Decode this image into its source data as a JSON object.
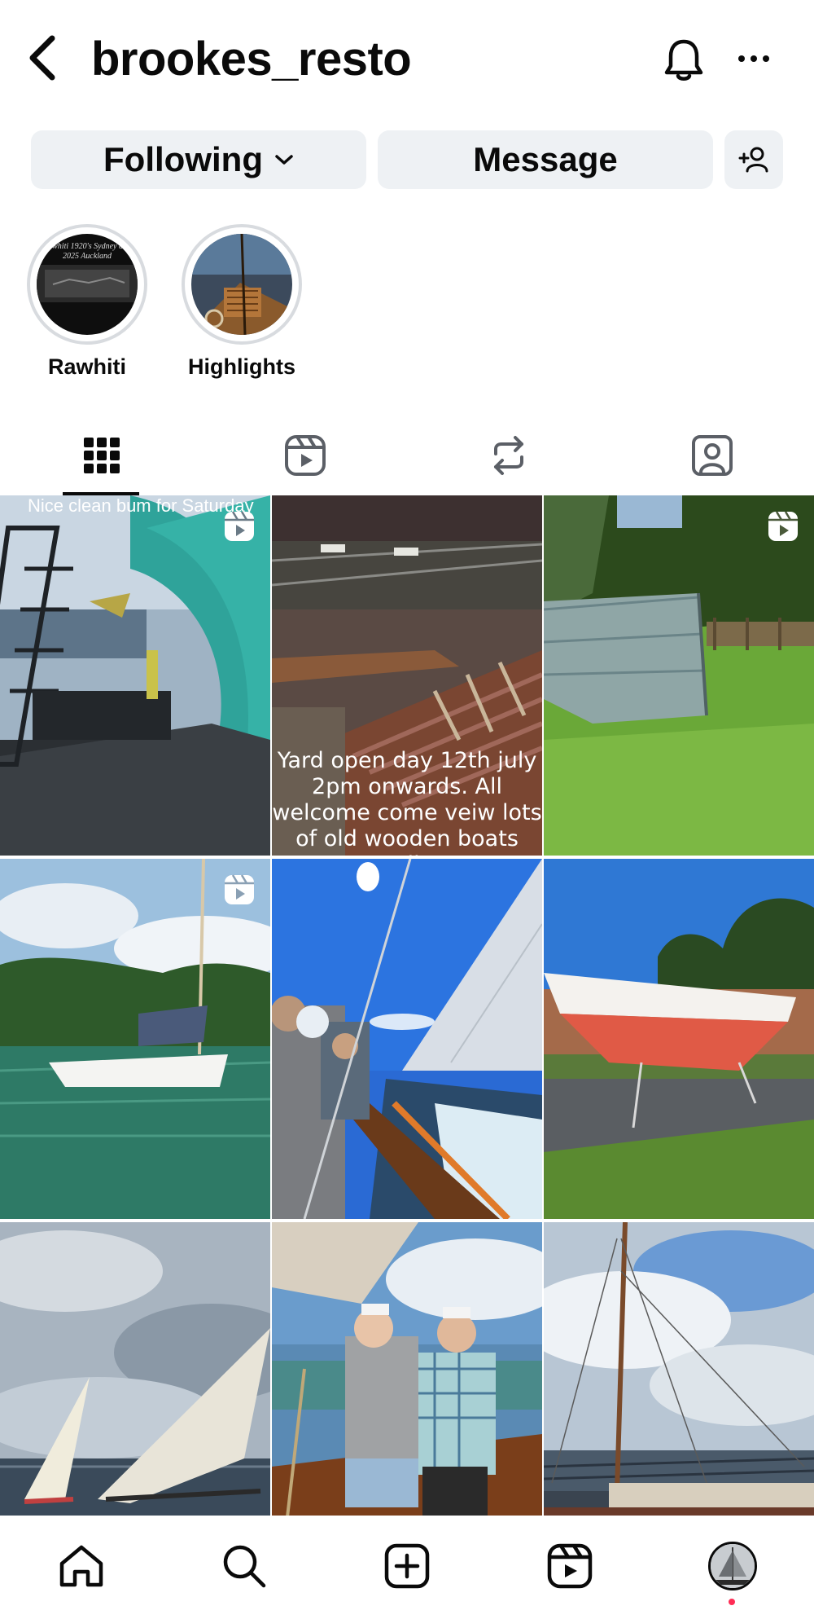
{
  "header": {
    "username": "brookes_resto",
    "back_icon": "chevron-left-icon",
    "bell_icon": "bell-icon",
    "more_icon": "more-horizontal-icon"
  },
  "actions": {
    "following_label": "Following",
    "message_label": "Message",
    "add_user_icon": "add-user-icon"
  },
  "highlights": [
    {
      "label": "Rawhiti",
      "cover_text": "Rawhiti 1920's Sydney and 2025 Auckland"
    },
    {
      "label": "Highlights"
    }
  ],
  "tabs": [
    {
      "name": "posts",
      "icon": "grid-icon",
      "active": true
    },
    {
      "name": "reels",
      "icon": "reels-icon",
      "active": false
    },
    {
      "name": "reposts",
      "icon": "repost-icon",
      "active": false
    },
    {
      "name": "tagged",
      "icon": "tagged-person-icon",
      "active": false
    }
  ],
  "grid": {
    "posts": [
      {
        "caption": "Nice clean bum for Saturday",
        "is_reel": true
      },
      {
        "caption": "Yard open  day 12th july 2pm onwards. All welcome come veiw  lots of old wooden boats mullet",
        "is_reel": false
      },
      {
        "caption": "",
        "is_reel": true
      },
      {
        "caption": "",
        "is_reel": true
      },
      {
        "caption": "",
        "is_reel": false
      },
      {
        "caption": "",
        "is_reel": false
      },
      {
        "caption": "",
        "is_reel": false
      },
      {
        "caption": "",
        "is_reel": false
      },
      {
        "caption": "",
        "is_reel": false
      }
    ]
  },
  "bottom_nav": [
    {
      "name": "home",
      "icon": "home-icon"
    },
    {
      "name": "search",
      "icon": "search-icon"
    },
    {
      "name": "create",
      "icon": "plus-square-icon"
    },
    {
      "name": "reels",
      "icon": "reels-icon"
    },
    {
      "name": "profile",
      "icon": "profile-avatar",
      "has_notification_dot": true
    }
  ],
  "colors": {
    "button_bg": "#eef1f4",
    "text": "#0a0a0a",
    "notification_dot": "#ff2d55"
  }
}
